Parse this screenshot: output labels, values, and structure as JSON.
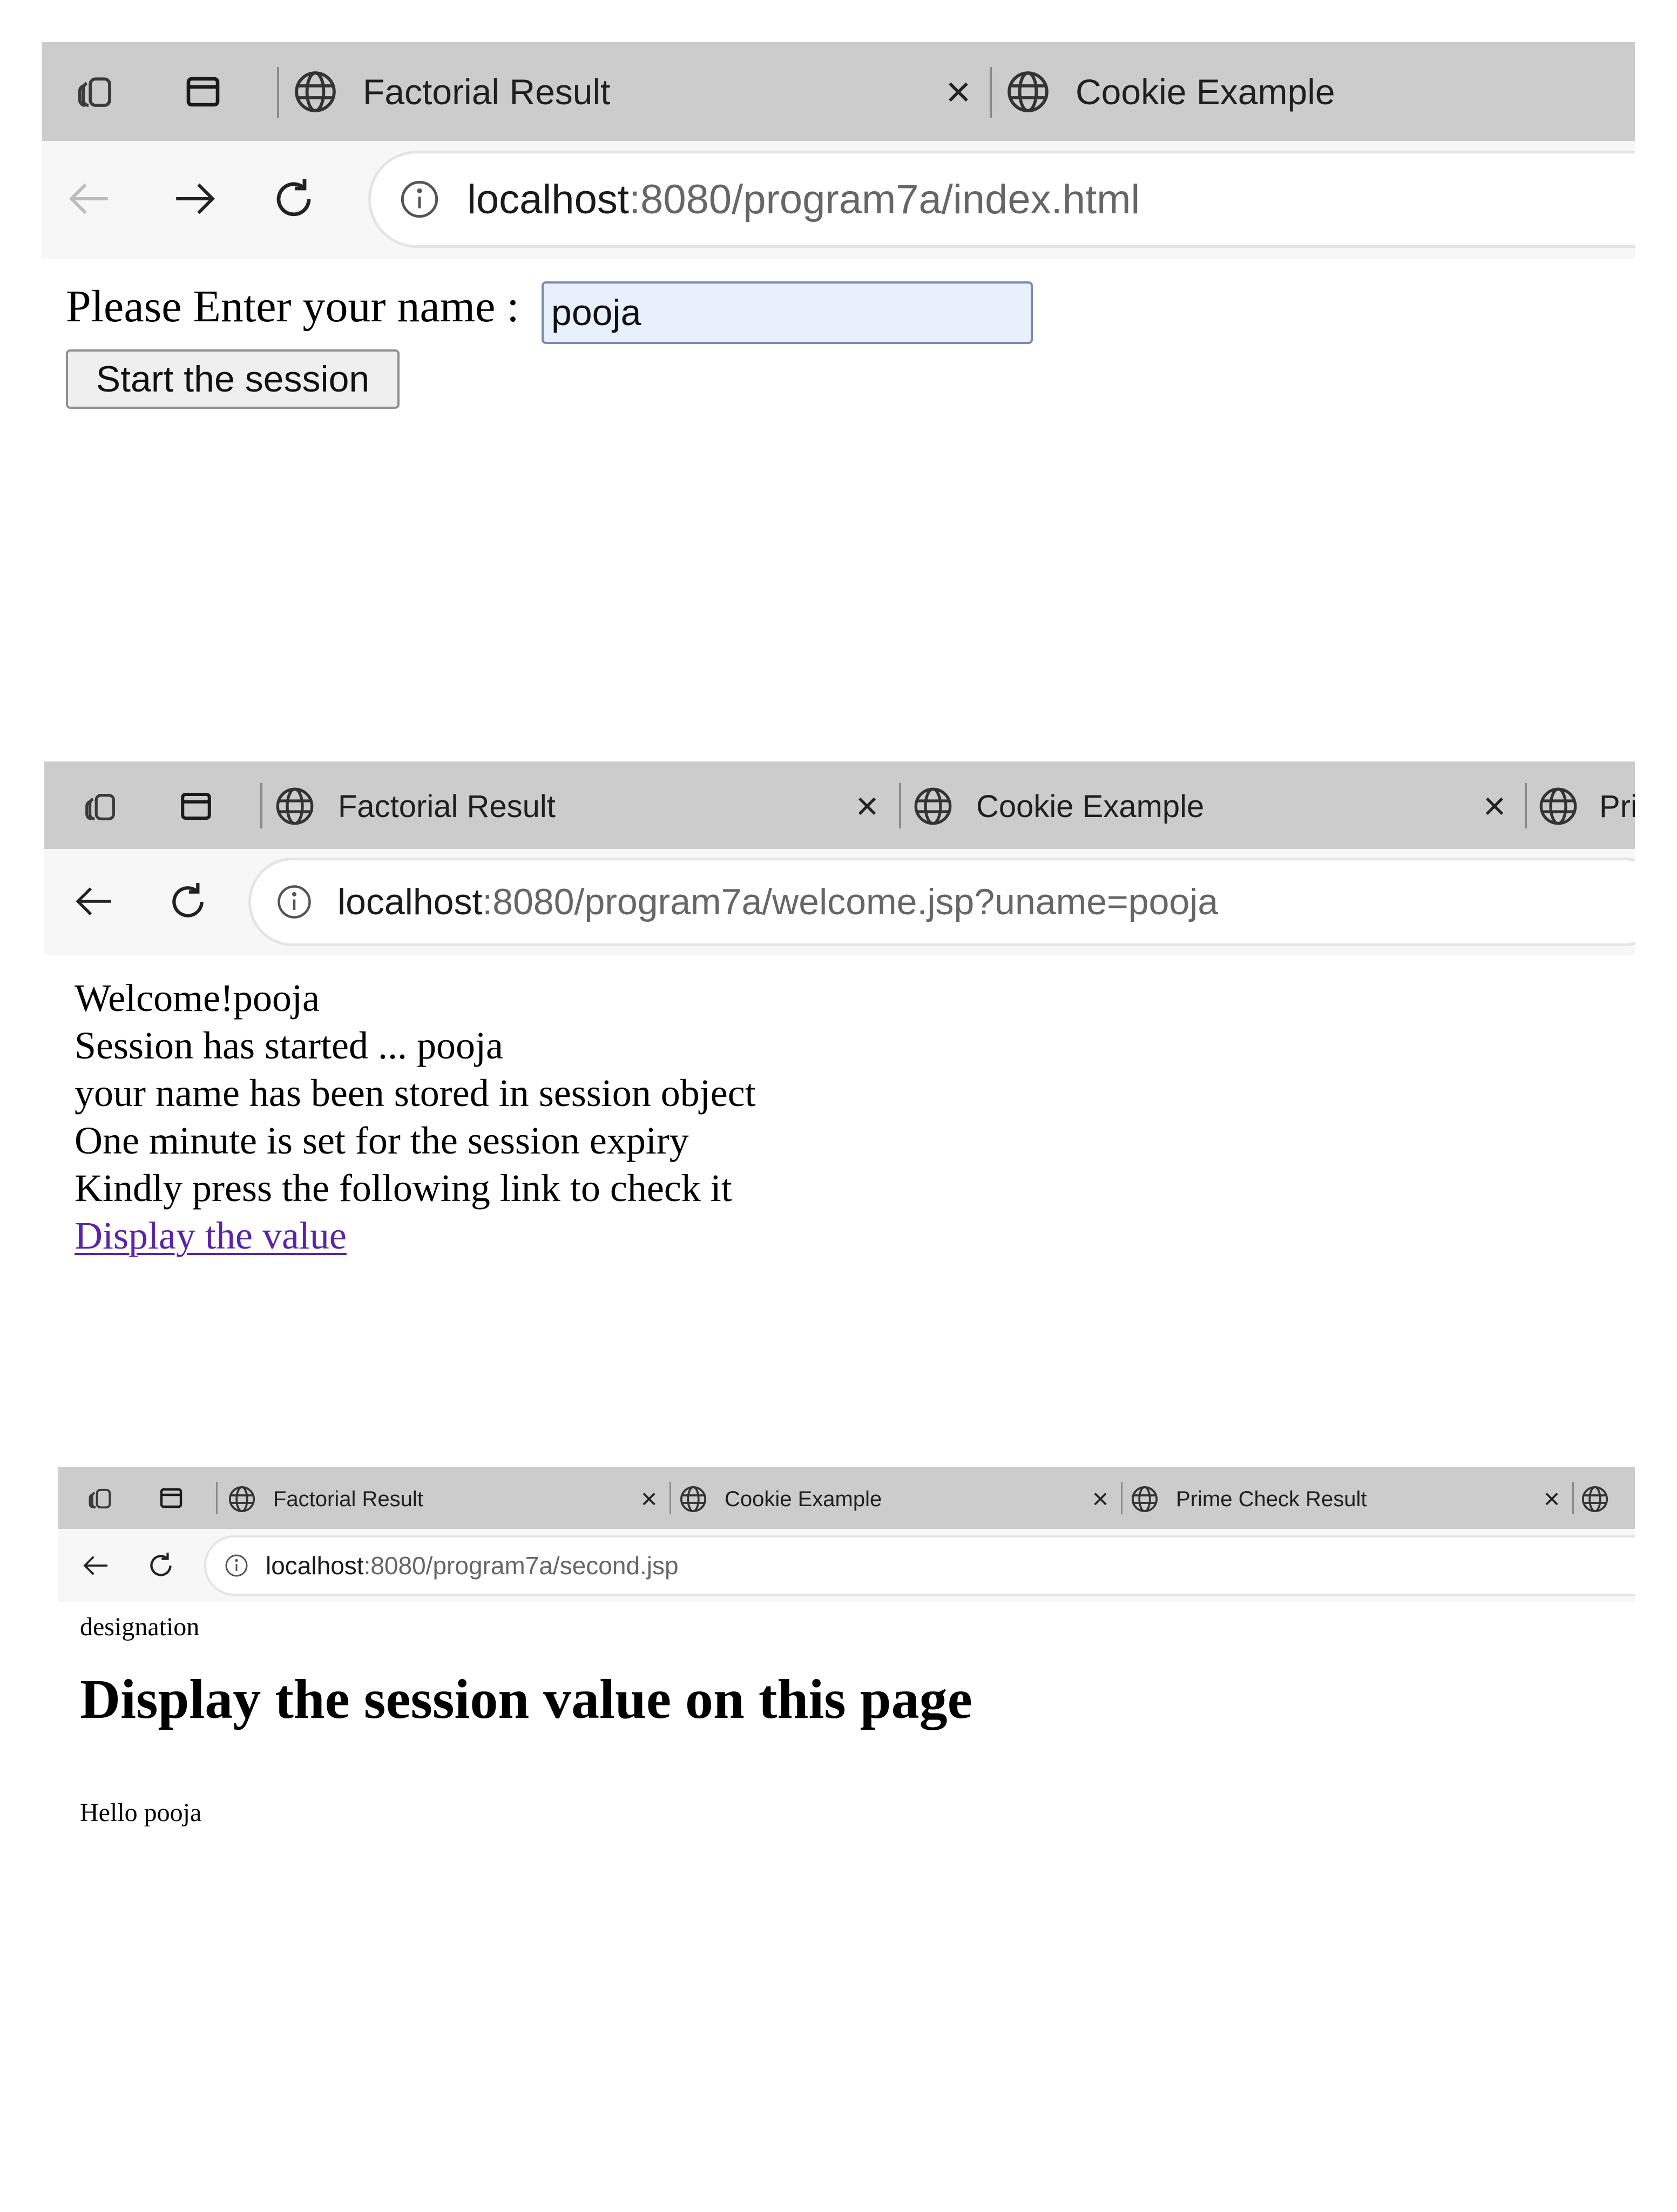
{
  "colors": {
    "tab_strip": "#cccccc",
    "address_bar": "#f7f7f7",
    "input_autofill": "#e8f0fe",
    "visited_link": "#5a24a8"
  },
  "screenshot1": {
    "tabs": [
      {
        "title": "Factorial Result",
        "close": "×"
      },
      {
        "title": "Cookie Example",
        "close": "×"
      }
    ],
    "url": {
      "host": "localhost",
      "rest": ":8080/program7a/index.html"
    },
    "page": {
      "label": "Please Enter your name :",
      "input_value": "pooja",
      "button_label": "Start the session"
    }
  },
  "screenshot2": {
    "tabs": [
      {
        "title": "Factorial Result",
        "close": "×"
      },
      {
        "title": "Cookie Example",
        "close": "×"
      },
      {
        "title": "Prin"
      }
    ],
    "url": {
      "host": "localhost",
      "rest": ":8080/program7a/welcome.jsp?uname=pooja"
    },
    "page": {
      "lines": [
        "Welcome!pooja",
        "Session has started ... pooja",
        "your name has been stored in session object",
        "One minute is set for the session expiry",
        "Kindly press the following link to check it"
      ],
      "link": "Display the value"
    }
  },
  "screenshot3": {
    "tabs": [
      {
        "title": "Factorial Result",
        "close": "×"
      },
      {
        "title": "Cookie Example",
        "close": "×"
      },
      {
        "title": "Prime Check Result",
        "close": "×"
      }
    ],
    "url": {
      "host": "localhost",
      "rest": ":8080/program7a/second.jsp"
    },
    "page": {
      "caption": "designation",
      "heading": "Display the session value on this page",
      "greeting": "Hello pooja"
    }
  }
}
